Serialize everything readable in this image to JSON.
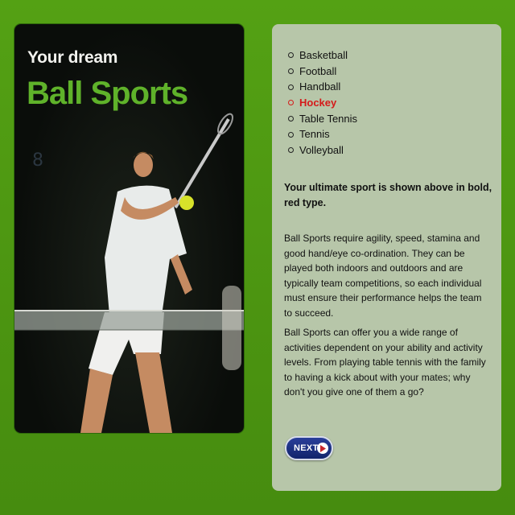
{
  "hero": {
    "subtitle": "Your dream",
    "title": "Ball Sports"
  },
  "sports": {
    "items": [
      {
        "label": "Basketball",
        "active": false
      },
      {
        "label": "Football",
        "active": false
      },
      {
        "label": "Handball",
        "active": false
      },
      {
        "label": "Hockey",
        "active": true
      },
      {
        "label": "Table Tennis",
        "active": false
      },
      {
        "label": "Tennis",
        "active": false
      },
      {
        "label": "Volleyball",
        "active": false
      }
    ]
  },
  "info": {
    "ultimate": "Your ultimate sport is shown above in bold, red type.",
    "para1": "Ball Sports require agility, speed, stamina and good hand/eye co-ordination. They can be played both indoors and outdoors and are typically team competitions, so each individual must ensure their performance helps the team to succeed.",
    "para2": "Ball Sports can offer you a wide range of activities dependent on your ability and activity levels. From playing table tennis with the family to having a kick about with your mates; why don't you give one of them a go?"
  },
  "nav": {
    "next_label": "NEXT",
    "next_icon": "play-arrow-icon"
  },
  "colors": {
    "background": "#4e9a12",
    "panel": "#b7c6a9",
    "title_green": "#5fb22a",
    "active_red": "#d51a1a",
    "button_blue": "#1a2f80"
  }
}
